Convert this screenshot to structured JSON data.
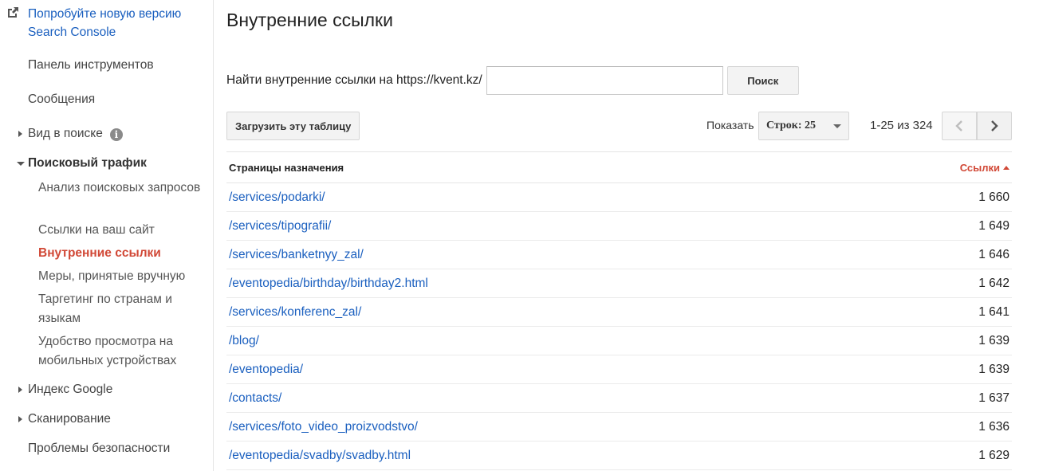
{
  "sidebar": {
    "try_new": "Попробуйте новую версию Search Console",
    "dashboard": "Панель инструментов",
    "messages": "Сообщения",
    "search_appearance": "Вид в поиске",
    "search_traffic": "Поисковый трафик",
    "sub": {
      "search_analytics": "Анализ поисковых запросов",
      "links_to_site": "Ссылки на ваш сайт",
      "internal_links": "Внутренние ссылки",
      "manual_actions": "Меры, принятые вручную",
      "intl_targeting": "Таргетинг по странам и языкам",
      "mobile_usability": "Удобство просмотра на мобильных устройствах"
    },
    "google_index": "Индекс Google",
    "crawl": "Сканирование",
    "security": "Проблемы безопасности"
  },
  "main": {
    "title": "Внутренние ссылки",
    "search_label": "Найти внутренние ссылки на https://kvent.kz/",
    "search_value": "",
    "search_button": "Поиск",
    "download_button": "Загрузить эту таблицу",
    "show_label": "Показать",
    "rows_select": "Строк: 25",
    "range": "1-25 из 324",
    "table": {
      "col_pages": "Страницы назначения",
      "col_links": "Ссылки",
      "sort_column": "Ссылки",
      "sort_direction": "descending",
      "rows": [
        {
          "url": "/services/podarki/",
          "count": "1 660"
        },
        {
          "url": "/services/tipografii/",
          "count": "1 649"
        },
        {
          "url": "/services/banketnyy_zal/",
          "count": "1 646"
        },
        {
          "url": "/eventopedia/birthday/birthday2.html",
          "count": "1 642"
        },
        {
          "url": "/services/konferenc_zal/",
          "count": "1 641"
        },
        {
          "url": "/blog/",
          "count": "1 639"
        },
        {
          "url": "/eventopedia/",
          "count": "1 639"
        },
        {
          "url": "/contacts/",
          "count": "1 637"
        },
        {
          "url": "/services/foto_video_proizvodstvo/",
          "count": "1 636"
        },
        {
          "url": "/eventopedia/svadby/svadby.html",
          "count": "1 629"
        }
      ]
    }
  },
  "colors": {
    "link": "#1a5fbf",
    "active": "#d14836"
  },
  "icons": {
    "external": "external-link-icon",
    "info": "info-icon",
    "prev": "chevron-left-icon",
    "next": "chevron-right-icon"
  }
}
